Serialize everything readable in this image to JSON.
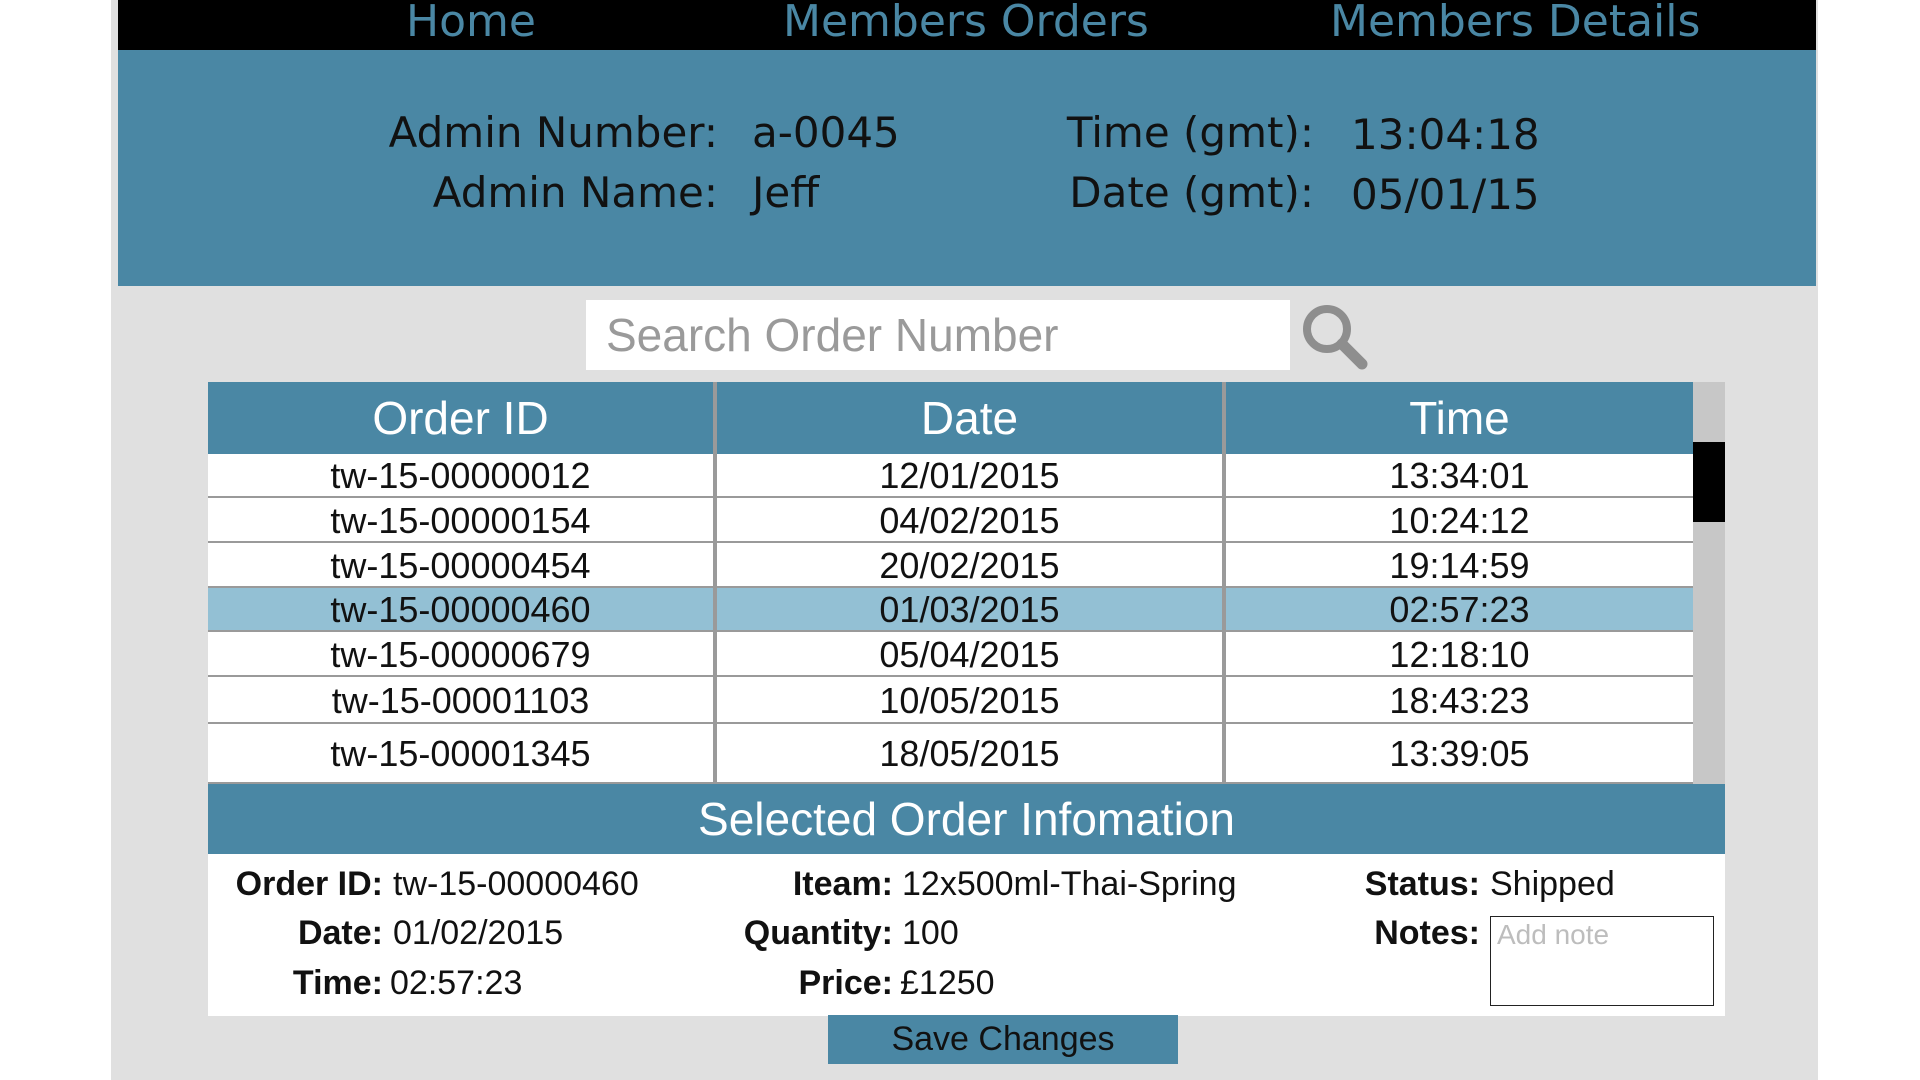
{
  "nav": {
    "home": "Home",
    "members_orders": "Members Orders",
    "members_details": "Members Details"
  },
  "admin": {
    "number_label": "Admin Number:",
    "number": "a-0045",
    "name_label": "Admin Name:",
    "name": "Jeff",
    "time_label": "Time (gmt):",
    "time": "13:04:18",
    "date_label": "Date (gmt):",
    "date": "05/01/15"
  },
  "search": {
    "placeholder": "Search Order Number"
  },
  "table": {
    "headers": [
      "Order ID",
      "Date",
      "Time"
    ],
    "rows": [
      {
        "order_id": "tw-15-00000012",
        "date": "12/01/2015",
        "time": "13:34:01"
      },
      {
        "order_id": "tw-15-00000154",
        "date": "04/02/2015",
        "time": "10:24:12"
      },
      {
        "order_id": "tw-15-00000454",
        "date": "20/02/2015",
        "time": "19:14:59"
      },
      {
        "order_id": "tw-15-00000460",
        "date": "01/03/2015",
        "time": "02:57:23"
      },
      {
        "order_id": "tw-15-00000679",
        "date": "05/04/2015",
        "time": "12:18:10"
      },
      {
        "order_id": "tw-15-00001103",
        "date": "10/05/2015",
        "time": "18:43:23"
      },
      {
        "order_id": "tw-15-00001345",
        "date": "18/05/2015",
        "time": "13:39:05"
      }
    ],
    "selected_index": 3
  },
  "detail": {
    "title": "Selected Order Infomation",
    "order_id_label": "Order ID:",
    "order_id": "tw-15-00000460",
    "date_label": "Date:",
    "date": "01/02/2015",
    "time_label": "Time:",
    "time": "02:57:23",
    "item_label": "Iteam:",
    "item": "12x500ml-Thai-Spring",
    "quantity_label": "Quantity:",
    "quantity": "100",
    "price_label": "Price:",
    "price": "£1250",
    "status_label": "Status:",
    "status": "Shipped",
    "notes_label": "Notes:",
    "notes_placeholder": "Add note"
  },
  "actions": {
    "save_label": "Save Changes"
  },
  "colors": {
    "accent": "#4a87a4",
    "selected_row": "#93c0d4",
    "nav_bg": "#000000",
    "page_bg": "#e0e0e0"
  },
  "icons": {
    "search": "search-icon"
  }
}
